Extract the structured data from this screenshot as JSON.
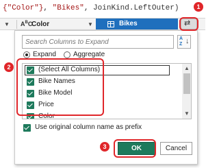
{
  "formula": {
    "str1": "{\"Color\"}",
    "sep1": ", ",
    "str2": "\"Bikes\"",
    "rest": ", JoinKind.LeftOuter)"
  },
  "columns": {
    "type_glyph": "ABC",
    "first_col": "Color",
    "second_col": "Bikes",
    "expand_icon": "expand-arrows-icon"
  },
  "panel": {
    "search_placeholder": "Search Columns to Expand",
    "sort_label": "A Z",
    "options": {
      "expand": "Expand",
      "aggregate": "Aggregate",
      "selected": "Expand"
    },
    "columns_list": [
      {
        "label": "(Select All Columns)",
        "checked": true
      },
      {
        "label": "Bike Names",
        "checked": true
      },
      {
        "label": "Bike Model",
        "checked": true
      },
      {
        "label": "Price",
        "checked": true
      },
      {
        "label": "Color",
        "checked": true
      }
    ],
    "prefix": {
      "label": "Use original column name as prefix",
      "checked": true
    },
    "ok_label": "OK",
    "cancel_label": "Cancel"
  },
  "annotations": {
    "step1": "1",
    "step2": "2",
    "step3": "3",
    "color": "#e0262a"
  },
  "colors": {
    "accent_blue": "#1f6fbd",
    "check_green": "#1e7a5c"
  }
}
